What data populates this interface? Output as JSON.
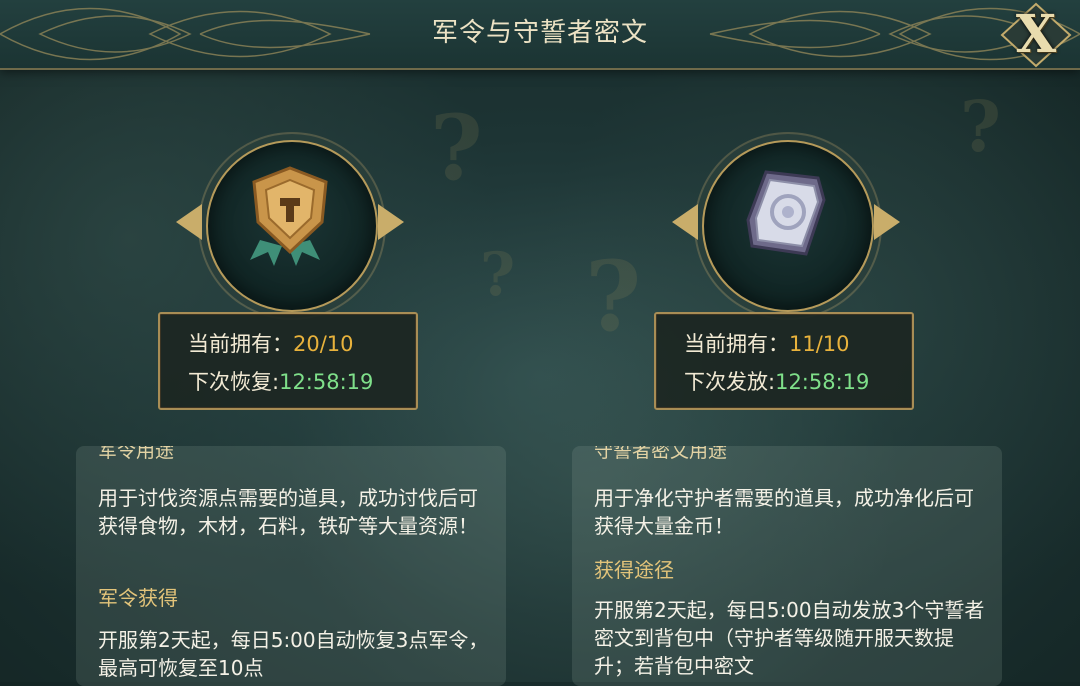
{
  "title": "军令与守誓者密文",
  "close_label": "X",
  "background_marks": [
    "?",
    "?",
    "?",
    "?"
  ],
  "left": {
    "item_icon": "golden-shield-badge-icon",
    "owned_label": "当前拥有：",
    "owned_value": "20/10",
    "next_label": "下次恢复:",
    "next_value": "12:58:19",
    "panel_title": "军令用途",
    "desc": "用于讨伐资源点需要的道具，成功讨伐后可获得食物，木材，石料，铁矿等大量资源！",
    "sub_title": "军令获得",
    "desc2": "开服第2天起，每日5:00自动恢复3点军令，最高可恢复至10点"
  },
  "right": {
    "item_icon": "silver-rune-stone-icon",
    "owned_label": "当前拥有：",
    "owned_value": "11/10",
    "next_label": "下次发放:",
    "next_value": "12:58:19",
    "panel_title": "守誓者密文用途",
    "desc": "用于净化守护者需要的道具，成功净化后可获得大量金币！",
    "sub_title": "获得途径",
    "desc2": "开服第2天起，每日5:00自动发放3个守誓者密文到背包中（守护者等级随开服天数提升；若背包中密文"
  },
  "colors": {
    "gold_value": "#e8b23c",
    "green_timer": "#7fe08a",
    "frame_gold": "#a88d55"
  }
}
